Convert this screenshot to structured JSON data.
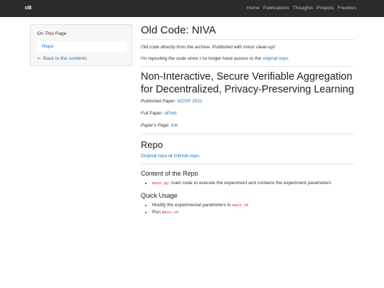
{
  "navbar": {
    "brand": "cB",
    "links": [
      "Home",
      "Publications",
      "Thoughts",
      "Projects",
      "Freebies"
    ]
  },
  "sidebar": {
    "title": "On This Page",
    "active_item": "Repo",
    "back_arrow": "⇐",
    "back_label": "Back to the contents"
  },
  "content": {
    "title": "Old Code: NIVA",
    "archive_note": "Old code directly from the archive. Published with minor clean-up!",
    "repost_text": "I'm reposting the code since I no longer have access to the",
    "repost_link": "original repo",
    "repost_end": ".",
    "paper_title": "Non-Interactive, Secure Verifiable Aggregation for Decentralized, Privacy-Preserving Learning",
    "published_label": "Published Paper:",
    "published_link": "ACISP 2021",
    "full_label": "Full Paper:",
    "full_link": "ePrint",
    "page_label": "Paper's Page:",
    "page_link": "link",
    "repo_heading": "Repo",
    "repo_link_original": "Original repo",
    "repo_or": "or",
    "repo_link_github": "GitHub repo",
    "repo_end": ".",
    "content_heading": "Content of the Repo",
    "content_item_code": "main.py",
    "content_item_text": ": main code to execute the experiment and contains the experiment parameters",
    "usage_heading": "Quick Usage",
    "usage_item1_text": "Modify the experimental parameters in",
    "usage_item1_code": "main.sh",
    "usage_item2_text": "Run",
    "usage_item2_code": "main.sh"
  }
}
